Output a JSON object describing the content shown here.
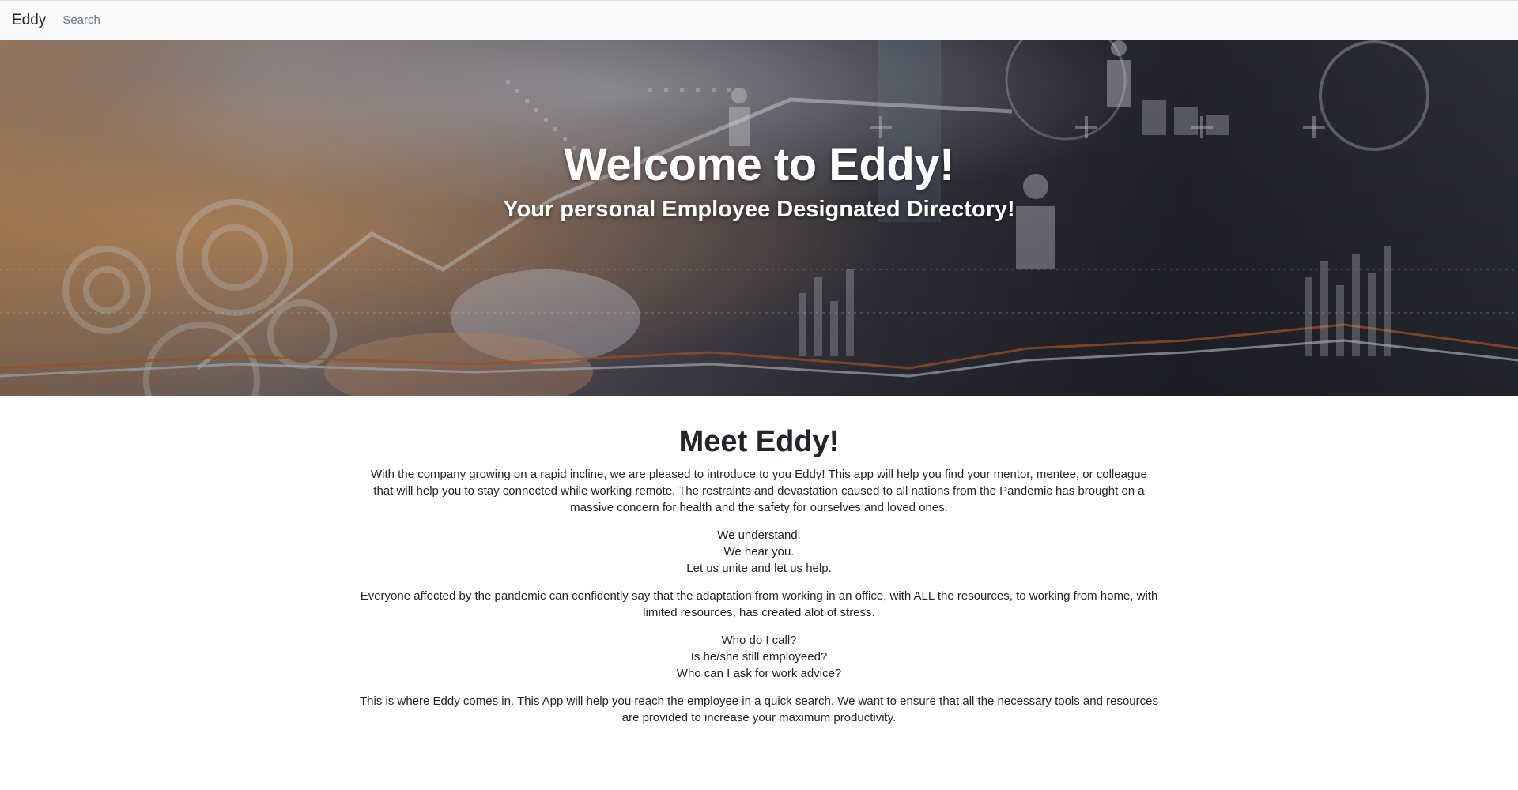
{
  "navbar": {
    "brand": "Eddy",
    "search_placeholder": "Search"
  },
  "hero": {
    "title": "Welcome to Eddy!",
    "subtitle": "Your personal Employee Designated Directory!"
  },
  "main": {
    "heading": "Meet Eddy!",
    "intro": "With the company growing on a rapid incline, we are pleased to introduce to you Eddy! This app will help you find your mentor, mentee, or colleague that will help you to stay connected while working remote. The restraints and devastation caused to all nations from the Pandemic has brought on a massive concern for health and the safety for ourselves and loved ones.",
    "empathy_lines": [
      "We understand.",
      "We hear you.",
      "Let us unite and let us help."
    ],
    "pandemic_text": "Everyone affected by the pandemic can confidently say that the adaptation from working in an office, with ALL the resources, to working from home, with limited resources, has created alot of stress.",
    "questions": [
      "Who do I call?",
      "Is he/she still employeed?",
      "Who can I ask for work advice?"
    ],
    "closing": "This is where Eddy comes in. This App will help you reach the employee in a quick search. We want to ensure that all the necessary tools and resources are provided to increase your maximum productivity."
  }
}
